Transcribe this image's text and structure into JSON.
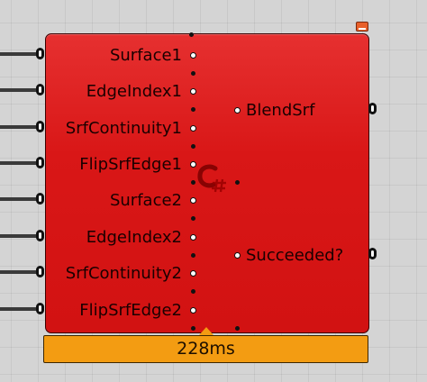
{
  "component": {
    "icon": "csharp-script-icon",
    "colors": {
      "body": "#d91717",
      "timing_bar": "#f39c12",
      "preview_flag": "#e9602a"
    },
    "inputs": [
      {
        "label": "Surface1"
      },
      {
        "label": "EdgeIndex1"
      },
      {
        "label": "SrfContinuity1"
      },
      {
        "label": "FlipSrfEdge1"
      },
      {
        "label": "Surface2"
      },
      {
        "label": "EdgeIndex2"
      },
      {
        "label": "SrfContinuity2"
      },
      {
        "label": "FlipSrfEdge2"
      }
    ],
    "outputs": [
      {
        "label": "BlendSrf"
      },
      {
        "label": "Succeeded?"
      }
    ],
    "timing": "228ms"
  }
}
